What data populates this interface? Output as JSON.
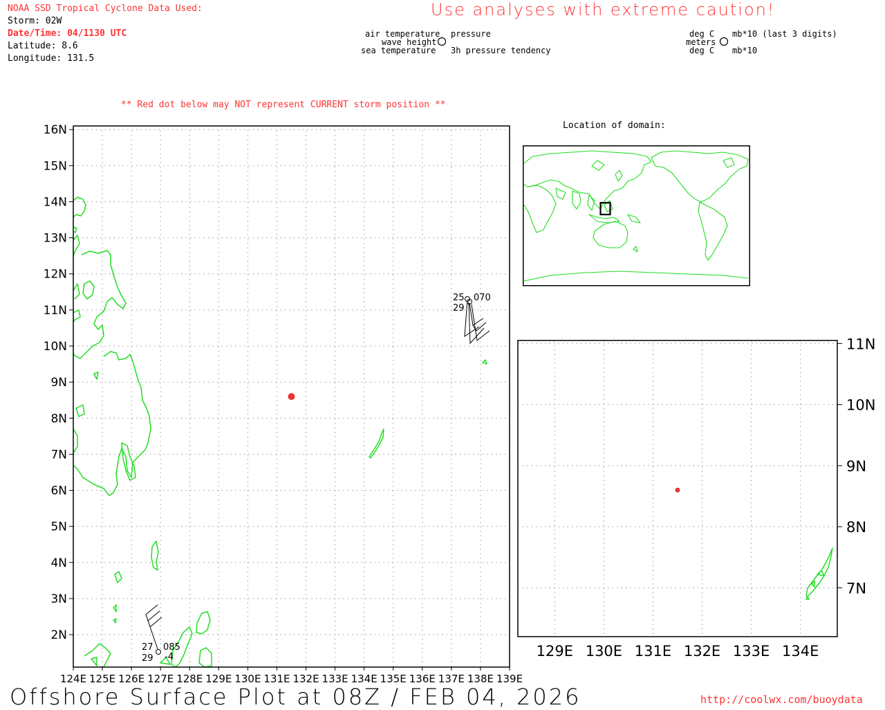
{
  "header": {
    "source_title": "NOAA SSD Tropical Cyclone Data Used:",
    "storm_line": "Storm: 02W",
    "datetime_line": "Date/Time: 04/1130 UTC",
    "latitude_line": "Latitude: 8.6",
    "longitude_line": "Longitude: 131.5",
    "warning": "Use analyses with extreme caution!"
  },
  "legend_left": {
    "air_temperature": "air temperature",
    "wave_height": "wave height",
    "sea_temperature": "sea temperature",
    "pressure": "pressure",
    "pressure_tendency": "3h pressure tendency"
  },
  "legend_right": {
    "deg_c_top": "deg C",
    "meters": "meters",
    "deg_c_bottom": "deg C",
    "mb_top": "mb*10 (last 3 digits)",
    "mb_bottom": "mb*10"
  },
  "red_dot_notice": "** Red dot below may NOT represent CURRENT storm position **",
  "inset_title": "Location of domain:",
  "main_map": {
    "lon_labels": [
      "124E",
      "125E",
      "126E",
      "127E",
      "128E",
      "129E",
      "130E",
      "131E",
      "132E",
      "133E",
      "134E",
      "135E",
      "136E",
      "137E",
      "138E",
      "139E"
    ],
    "lat_labels": [
      "16N",
      "15N",
      "14N",
      "13N",
      "12N",
      "11N",
      "10N",
      "9N",
      "8N",
      "7N",
      "6N",
      "5N",
      "4N",
      "3N",
      "2N"
    ],
    "lon_range": [
      124,
      139
    ],
    "lat_range": [
      1.1,
      16.1
    ],
    "storm": {
      "lat": 8.6,
      "lon": 131.5,
      "color": "#ee3333"
    },
    "station_ne": {
      "air_temp": "25",
      "pressure": "070",
      "sea_temp": "29"
    },
    "station_sw": {
      "air_temp": "27",
      "pressure": "085",
      "sea_temp": "29",
      "tendency": "-4"
    }
  },
  "zoom_map": {
    "lon_labels": [
      "129E",
      "130E",
      "131E",
      "132E",
      "133E",
      "134E"
    ],
    "lat_labels": [
      "11N",
      "10N",
      "9N",
      "8N",
      "7N"
    ],
    "lon_range": [
      128.25,
      134.75
    ],
    "lat_range": [
      6.2,
      11.05
    ]
  },
  "colors": {
    "coast": "#22dd22",
    "warning": "#ff3333",
    "storm": "#ee3333"
  },
  "footer": {
    "title": "Offshore Surface Plot at 08Z / FEB 04, 2026",
    "url": "http://coolwx.com/buoydata"
  }
}
